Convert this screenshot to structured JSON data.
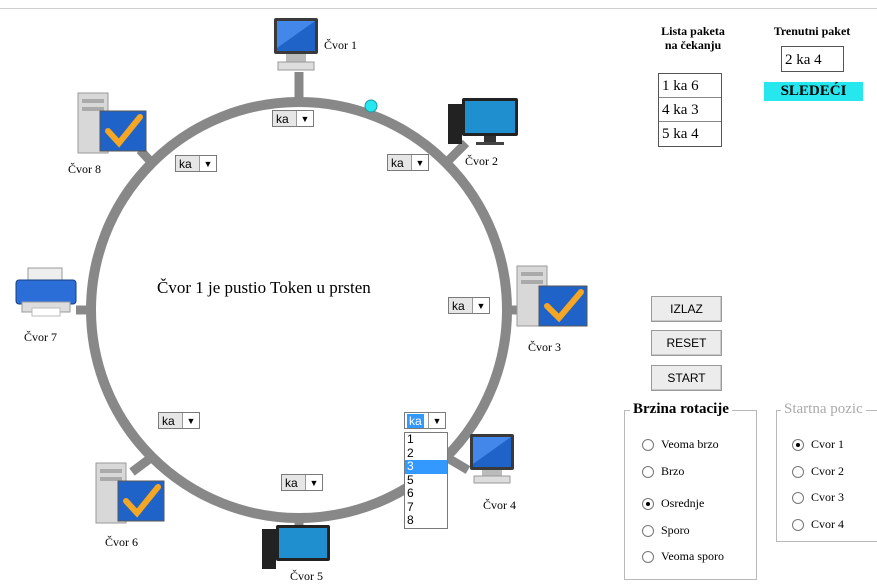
{
  "nodes": [
    {
      "label": "Čvor 1",
      "icon": "monitor-tower-icon"
    },
    {
      "label": "Čvor 2",
      "icon": "desktop-computer-icon"
    },
    {
      "label": "Čvor 3",
      "icon": "server-tower-icon"
    },
    {
      "label": "Čvor 4",
      "icon": "monitor-tower-icon"
    },
    {
      "label": "Čvor 5",
      "icon": "desktop-computer-icon"
    },
    {
      "label": "Čvor 6",
      "icon": "server-tower-icon"
    },
    {
      "label": "Čvor 7",
      "icon": "printer-icon"
    },
    {
      "label": "Čvor 8",
      "icon": "server-tower-icon"
    }
  ],
  "ring": {
    "message": "Čvor 1 je pustio Token u prsten",
    "dropdown_value": "ka",
    "open_dropdown_options": [
      "1",
      "2",
      "3",
      "5",
      "6",
      "7",
      "8"
    ],
    "open_dropdown_highlighted": "3",
    "token_color": "#26e6ee",
    "ring_color": "#888888"
  },
  "queue": {
    "title_line1": "Lista paketa",
    "title_line2": "na čekanju",
    "items": [
      "1  ka  6",
      "4  ka  3",
      "5  ka  4"
    ]
  },
  "current": {
    "title": "Trenutni paket",
    "value": "2  ka  4",
    "next_label": "SLEDEĆI",
    "next_color": "#26e6ee"
  },
  "buttons": {
    "exit": "IZLAZ",
    "reset": "RESET",
    "start": "START"
  },
  "speed": {
    "title": "Brzina rotacije",
    "options": [
      "Veoma brzo",
      "Brzo",
      "Osrednje",
      "Sporo",
      "Veoma sporo"
    ],
    "selected": "Osrednje"
  },
  "start_pos": {
    "title": "Startna pozic",
    "options": [
      "Cvor 1",
      "Cvor 2",
      "Cvor 3",
      "Cvor 4"
    ],
    "selected": "Cvor 1"
  }
}
